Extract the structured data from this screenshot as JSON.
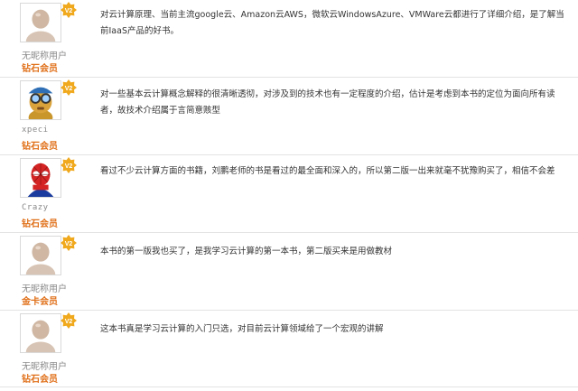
{
  "reviews": [
    {
      "avatar": "default-user-avatar",
      "badge": "V2",
      "username": "无昵称用户",
      "tier": "钻石会员",
      "content": "对云计算原理、当前主流google云、Amazon云AWS，微软云WindowsAzure、VMWare云都进行了详细介绍，是了解当前IaaS产品的好书。"
    },
    {
      "avatar": "goggles-character-avatar",
      "badge": "V2",
      "username": "xpeci",
      "tier": "钻石会员",
      "content": "对一些基本云计算概念解释的很清晰透彻，对涉及到的技术也有一定程度的介绍，估计是考虑到本书的定位为面向所有读者，故技术介绍属于言简意赅型"
    },
    {
      "avatar": "spiderman-avatar",
      "badge": "V2",
      "username": "Crazy",
      "tier": "钻石会员",
      "content": "看过不少云计算方面的书籍，刘鹏老师的书是看过的最全面和深入的，所以第二版一出来就毫不犹豫购买了，相信不会差"
    },
    {
      "avatar": "default-user-avatar",
      "badge": "V2",
      "username": "无昵称用户",
      "tier": "金卡会员",
      "content": "本书的第一版我也买了，是我学习云计算的第一本书，第二版买来是用做教材"
    },
    {
      "avatar": "default-user-avatar",
      "badge": "V2",
      "username": "无昵称用户",
      "tier": "钻石会员",
      "content": "这本书真是学习云计算的入门只选，对目前云计算领域给了一个宏观的讲解"
    }
  ],
  "colors": {
    "tier": "#e0701a",
    "badge": "#f0a81c",
    "divider": "#e3e3e3",
    "text": "#333333"
  }
}
